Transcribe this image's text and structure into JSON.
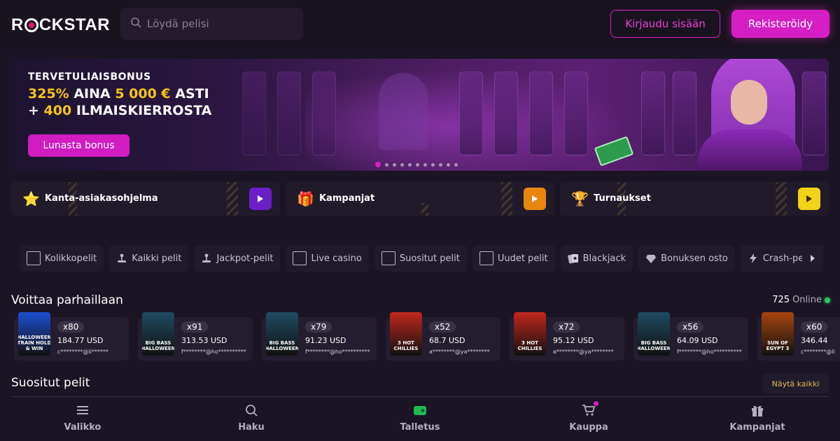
{
  "brand": {
    "logo_text_left": "R",
    "logo_text_right": "CKSTAR"
  },
  "search": {
    "placeholder": "Löydä pelisi"
  },
  "header": {
    "login_label": "Kirjaudu sisään",
    "register_label": "Rekisteröidy"
  },
  "banner": {
    "kicker": "TERVETULIAISBONUS",
    "line1_part1": "325%",
    "line1_part2": " AINA ",
    "line1_part3": "5 000 €",
    "line1_part4": " ASTI",
    "line2_part1": "+ ",
    "line2_part2": "400",
    "line2_part3": " ILMAISKIERROSTA",
    "cta_label": "Lunasta bonus",
    "slide_count": 11,
    "active_slide": 1
  },
  "promos": [
    {
      "icon": "star-icon",
      "glyph": "⭐",
      "label": "Kanta-asiakasohjelma",
      "accent": "#6a1fc9"
    },
    {
      "icon": "gift-icon",
      "glyph": "🎁",
      "label": "Kampanjat",
      "accent": "#e8860f"
    },
    {
      "icon": "trophy-icon",
      "glyph": "🏆",
      "label": "Turnaukset",
      "accent": "#f2d31a"
    }
  ],
  "categories": [
    {
      "icon": "square-icon",
      "label": "Kolikkopelit"
    },
    {
      "icon": "joystick-icon",
      "label": "Kaikki pelit"
    },
    {
      "icon": "joystick-icon",
      "label": "Jackpot-pelit"
    },
    {
      "icon": "square-icon",
      "label": "Live casino"
    },
    {
      "icon": "square-icon",
      "label": "Suositut pelit"
    },
    {
      "icon": "square-icon",
      "label": "Uudet pelit"
    },
    {
      "icon": "cards-icon",
      "label": "Blackjack"
    },
    {
      "icon": "diamond-icon",
      "label": "Bonuksen osto"
    },
    {
      "icon": "lightning-icon",
      "label": "Crash-pelit"
    }
  ],
  "winners": {
    "title": "Voittaa parhaillaan",
    "online_count": "725",
    "online_label": "Online",
    "items": [
      {
        "game": "HALLOWEEN TRAIN HOLD & WIN",
        "mult": "x80",
        "amount": "184.77 USD",
        "user": "c********@li******",
        "theme": "#1d4fd1"
      },
      {
        "game": "BIG BASS HALLOWEEN",
        "mult": "x91",
        "amount": "313.53 USD",
        "user": "f********@ho**********",
        "theme": "#1f4b63"
      },
      {
        "game": "BIG BASS HALLOWEEN",
        "mult": "x79",
        "amount": "91.23 USD",
        "user": "f********@ho**********",
        "theme": "#1f4b63"
      },
      {
        "game": "3 HOT CHILLIES",
        "mult": "x52",
        "amount": "68.7 USD",
        "user": "a********@ya********",
        "theme": "#c1271c"
      },
      {
        "game": "3 HOT CHILLIES",
        "mult": "x72",
        "amount": "95.12 USD",
        "user": "a********@ya********",
        "theme": "#c1271c"
      },
      {
        "game": "BIG BASS HALLOWEEN",
        "mult": "x56",
        "amount": "64.09 USD",
        "user": "f********@ho**********",
        "theme": "#1f4b63"
      },
      {
        "game": "SUN OF EGYPT 3",
        "mult": "x60",
        "amount": "346.44",
        "user": "c********@li",
        "theme": "#a8440c"
      }
    ]
  },
  "popular": {
    "title": "Suositut pelit",
    "show_all": "Näytä kaikki"
  },
  "bottom_nav": [
    {
      "icon": "menu-icon",
      "label": "Valikko"
    },
    {
      "icon": "search-icon",
      "label": "Haku"
    },
    {
      "icon": "wallet-icon",
      "label": "Talletus"
    },
    {
      "icon": "cart-icon",
      "label": "Kauppa"
    },
    {
      "icon": "gift-icon",
      "label": "Kampanjat"
    }
  ]
}
